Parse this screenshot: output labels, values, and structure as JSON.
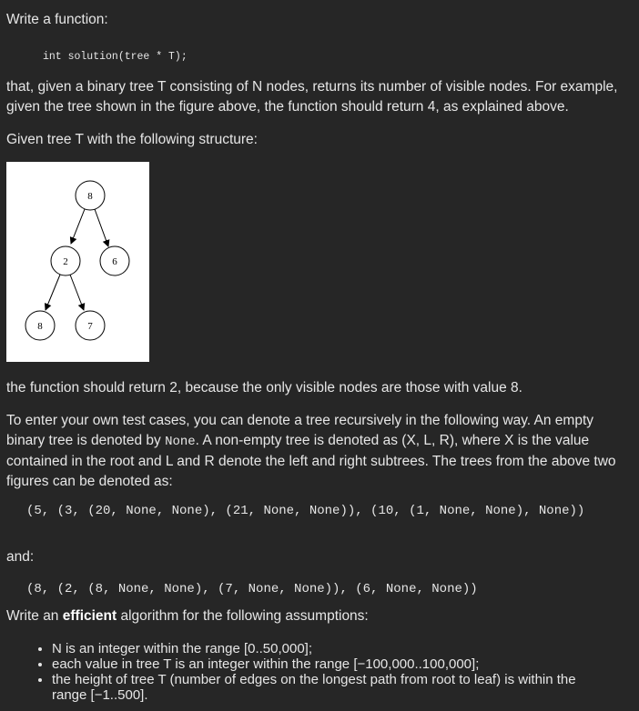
{
  "intro": {
    "write_function": "Write a function:",
    "signature": "int solution(tree * T);",
    "description": "that, given a binary tree T consisting of N nodes, returns its number of visible nodes. For example, given the tree shown in the figure above, the function should return 4, as explained above.",
    "given_tree": "Given tree T with the following structure:"
  },
  "figure": {
    "nodes": [
      {
        "id": "root",
        "label": "8"
      },
      {
        "id": "left",
        "label": "2"
      },
      {
        "id": "right",
        "label": "6"
      },
      {
        "id": "left-left",
        "label": "8"
      },
      {
        "id": "left-right",
        "label": "7"
      }
    ]
  },
  "result_text": "the function should return 2, because the only visible nodes are those with value 8.",
  "test_cases": {
    "p1": "To enter your own test cases, you can denote a tree recursively in the following way. An empty binary tree is denoted by ",
    "none_keyword": "None",
    "p2": ". A non-empty tree is denoted as (X, L, R), where X is the value contained in the root and L and R denote the left and right subtrees. The trees from the above two figures can be denoted as:",
    "example1": "(5, (3, (20, None, None), (21, None, None)), (10, (1, None, None), None))",
    "and_label": "and:",
    "example2": "(8, (2, (8, None, None), (7, None, None)), (6, None, None))"
  },
  "assumptions": {
    "prefix": "Write an ",
    "emphasis": "efficient",
    "suffix": " algorithm for the following assumptions:",
    "items": [
      "N is an integer within the range [0..50,000];",
      "each value in tree T is an integer within the range [−100,000..100,000];",
      "the height of tree T (number of edges on the longest path from root to leaf) is within the range [−1..500]."
    ]
  }
}
